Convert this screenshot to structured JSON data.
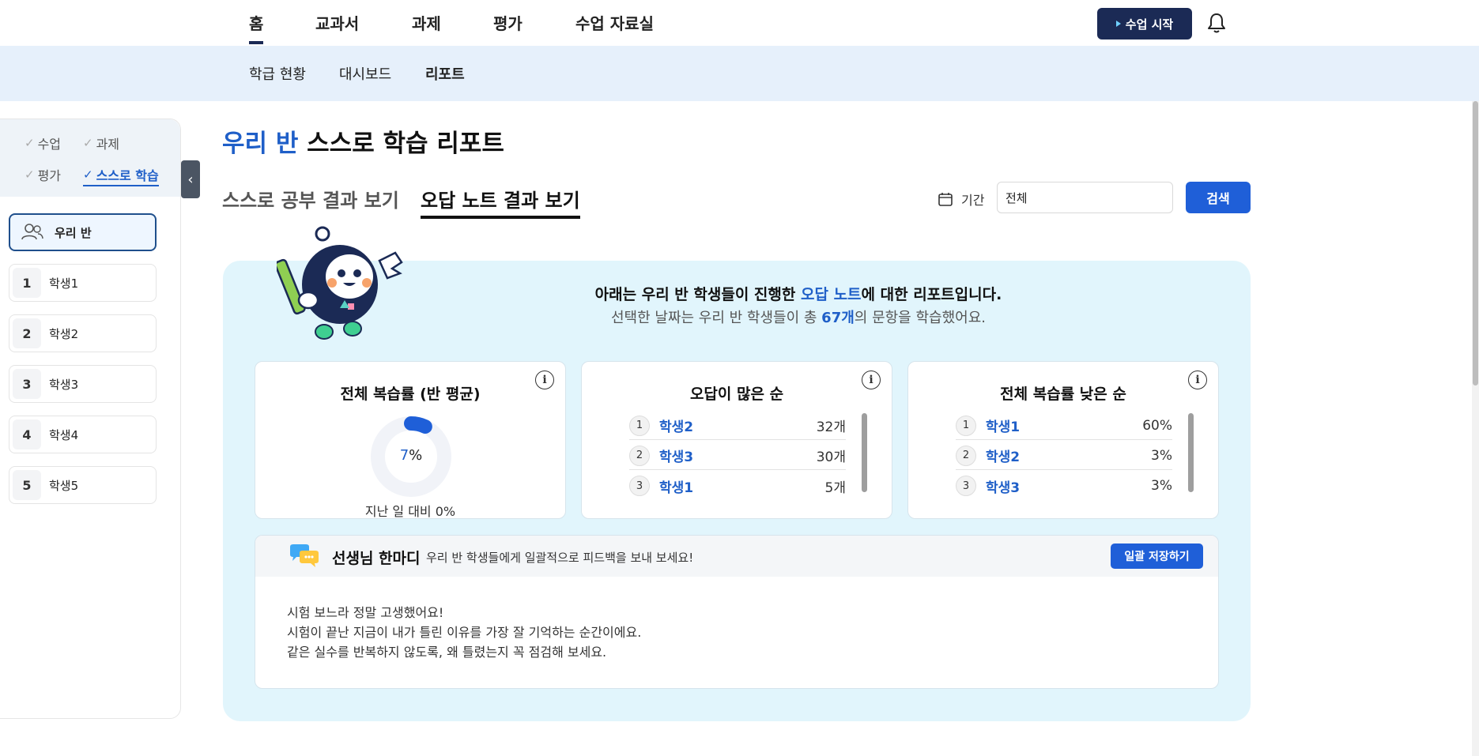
{
  "topnav": {
    "tabs": [
      {
        "label": "홈",
        "active": true
      },
      {
        "label": "교과서"
      },
      {
        "label": "과제"
      },
      {
        "label": "평가"
      },
      {
        "label": "수업 자료실"
      }
    ],
    "start_button": "수업 시작",
    "bell_icon": "bell-icon"
  },
  "subnav": {
    "items": [
      {
        "label": "학급 현황"
      },
      {
        "label": "대시보드"
      },
      {
        "label": "리포트",
        "active": true
      }
    ]
  },
  "sidebar": {
    "filters": [
      {
        "label": "수업",
        "checked": false
      },
      {
        "label": "과제",
        "checked": false
      },
      {
        "label": "평가",
        "checked": false
      },
      {
        "label": "스스로 학습",
        "checked": true
      }
    ],
    "class_item": "우리 반",
    "students": [
      {
        "num": "1",
        "name": "학생1"
      },
      {
        "num": "2",
        "name": "학생2"
      },
      {
        "num": "3",
        "name": "학생3"
      },
      {
        "num": "4",
        "name": "학생4"
      },
      {
        "num": "5",
        "name": "학생5"
      }
    ]
  },
  "main": {
    "title_highlight": "우리 반",
    "title_rest": " 스스로 학습 리포트",
    "view_tabs": [
      {
        "label": "스스로 공부 결과 보기",
        "active": false
      },
      {
        "label": "오답 노트 결과 보기",
        "active": true
      }
    ],
    "period_label": "기간",
    "period_value": "전체",
    "search_button": "검색",
    "intro_line1_pre": "아래는 우리 반 학생들이 진행한 ",
    "intro_line1_highlight": "오답 노트",
    "intro_line1_post": "에 대한 리포트입니다.",
    "intro_line2_pre": "선택한 날짜는 우리 반 학생들이 총 ",
    "intro_line2_highlight": "67개",
    "intro_line2_post": "의 문항을 학습했어요."
  },
  "cards": {
    "review_rate": {
      "title": "전체 복습률 (반 평균)",
      "value": "7",
      "unit": "%",
      "fraction": 0.07,
      "compare": "지난 일 대비 0%"
    },
    "most_wrong": {
      "title": "오답이 많은 순",
      "rows": [
        {
          "rank": "1",
          "name": "학생2",
          "value": "32개"
        },
        {
          "rank": "2",
          "name": "학생3",
          "value": "30개"
        },
        {
          "rank": "3",
          "name": "학생1",
          "value": "5개"
        }
      ]
    },
    "low_review": {
      "title": "전체 복습률 낮은 순",
      "rows": [
        {
          "rank": "1",
          "name": "학생1",
          "value": "60%"
        },
        {
          "rank": "2",
          "name": "학생2",
          "value": "3%"
        },
        {
          "rank": "3",
          "name": "학생3",
          "value": "3%"
        }
      ]
    }
  },
  "comment": {
    "title": "선생님 한마디",
    "desc": "우리 반 학생들에게 일괄적으로 피드백을 보내 보세요!",
    "save_button": "일괄 저장하기",
    "lines": [
      "시험 보느라 정말 고생했어요!",
      "시험이 끝난 지금이 내가 틀린 이유를 가장 잘 기억하는 순간이에요.",
      "같은 실수를 반복하지 않도록, 왜 틀렸는지 꼭 점검해 보세요."
    ]
  },
  "colors": {
    "accent": "#1f5fd8",
    "navy": "#1b2a55",
    "panel_bg": "#e1f5fc"
  }
}
